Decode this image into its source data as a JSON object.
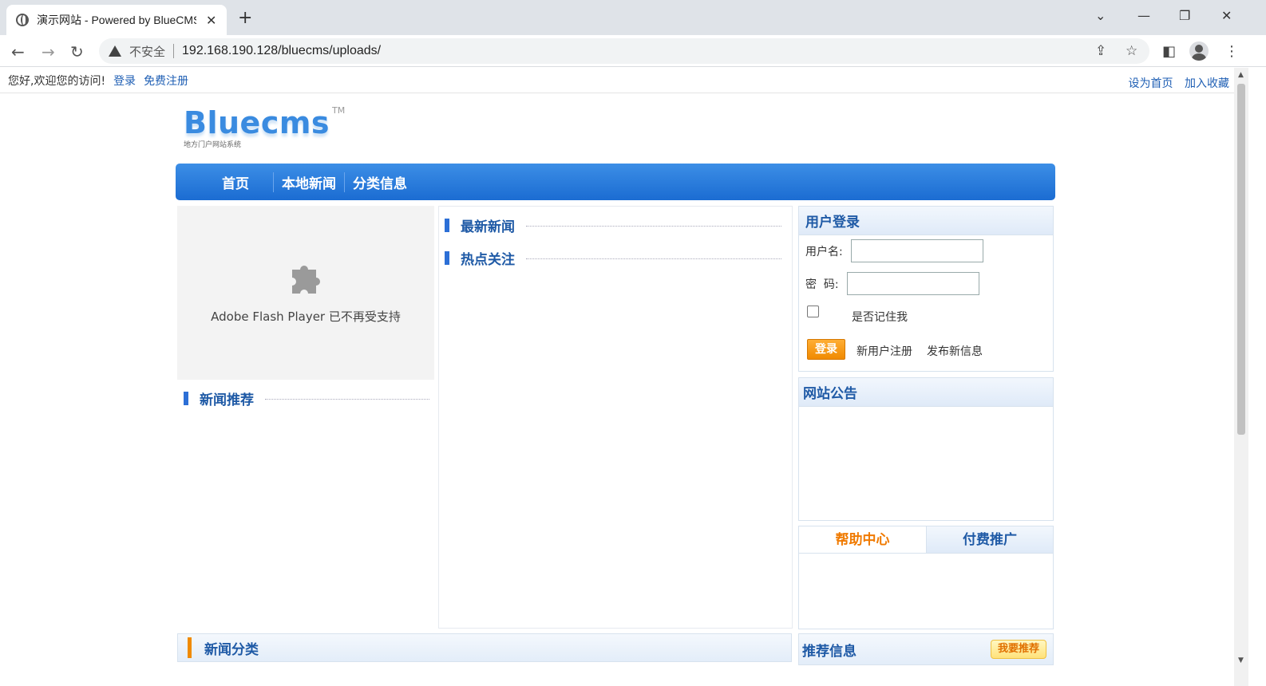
{
  "browser": {
    "tab_title": "演示网站 - Powered by BlueCMS",
    "insecure_label": "不安全",
    "url": "192.168.190.128/bluecms/uploads/"
  },
  "topbar": {
    "welcome": "您好,欢迎您的访问!",
    "login": "登录",
    "register": "免费注册",
    "set_home": "设为首页",
    "bookmark": "加入收藏"
  },
  "logo": {
    "name": "Bluecms",
    "tm": "TM",
    "subtitle": "地方门户网站系统"
  },
  "nav": {
    "items": [
      "首页",
      "本地新闻",
      "分类信息"
    ]
  },
  "flash": {
    "message": "Adobe Flash Player 已不再受支持"
  },
  "sections": {
    "news_recommend": "新闻推荐",
    "latest_news": "最新新闻",
    "hot_topics": "热点关注",
    "news_category": "新闻分类",
    "recommended_info": "推荐信息",
    "recommend_button": "我要推荐"
  },
  "login": {
    "title": "用户登录",
    "username_label": "用户名:",
    "password_label": "密  码:",
    "remember": "是否记住我",
    "submit": "登录",
    "new_user": "新用户注册",
    "post_new": "发布新信息"
  },
  "notice": {
    "title": "网站公告"
  },
  "help_tabs": [
    "帮助中心",
    "付费推广"
  ],
  "colors": {
    "brand_blue": "#1b6cd2",
    "accent_orange": "#f08a00"
  }
}
